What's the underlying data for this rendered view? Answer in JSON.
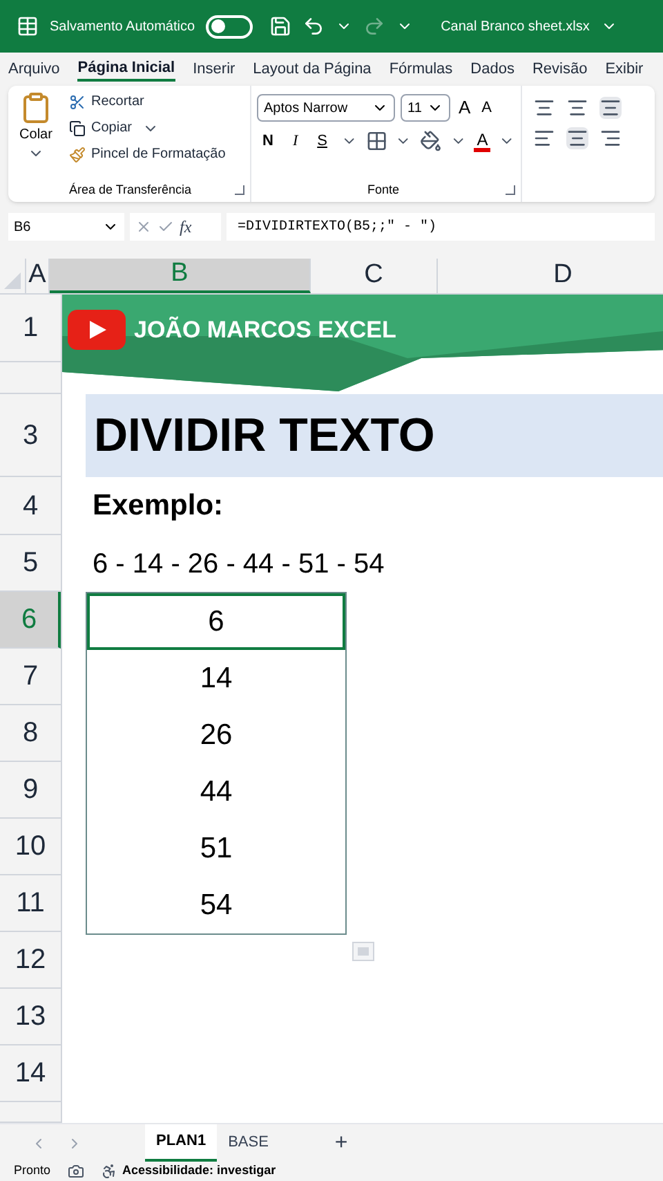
{
  "title_bar": {
    "autosave_label": "Salvamento Automático",
    "autosave_on": false,
    "filename": "Canal Branco sheet.xlsx"
  },
  "menu_tabs": [
    {
      "label": "Arquivo",
      "selected": false
    },
    {
      "label": "Página Inicial",
      "selected": true
    },
    {
      "label": "Inserir",
      "selected": false
    },
    {
      "label": "Layout da Página",
      "selected": false
    },
    {
      "label": "Fórmulas",
      "selected": false
    },
    {
      "label": "Dados",
      "selected": false
    },
    {
      "label": "Revisão",
      "selected": false
    },
    {
      "label": "Exibir",
      "selected": false
    }
  ],
  "ribbon": {
    "clipboard": {
      "paste": "Colar",
      "cut": "Recortar",
      "copy": "Copiar",
      "format_painter": "Pincel de Formatação",
      "label": "Área de Transferência"
    },
    "font": {
      "name": "Aptos Narrow",
      "size": "11",
      "grow": "A",
      "shrink": "A",
      "bold": "N",
      "italic": "I",
      "underline": "S",
      "font_color": "A",
      "label": "Fonte"
    }
  },
  "formula_bar": {
    "name_box": "B6",
    "fx": "fx",
    "formula": "=DIVIDIRTEXTO(B5;;\" - \")"
  },
  "sheet": {
    "columns": [
      {
        "label": "A",
        "selected": false
      },
      {
        "label": "B",
        "selected": true
      },
      {
        "label": "C",
        "selected": false
      },
      {
        "label": "D",
        "selected": false
      }
    ],
    "rows": [
      {
        "label": "1",
        "selected": false
      },
      {
        "label": "",
        "selected": false
      },
      {
        "label": "3",
        "selected": false
      },
      {
        "label": "4",
        "selected": false
      },
      {
        "label": "5",
        "selected": false
      },
      {
        "label": "6",
        "selected": true
      },
      {
        "label": "7",
        "selected": false
      },
      {
        "label": "8",
        "selected": false
      },
      {
        "label": "9",
        "selected": false
      },
      {
        "label": "10",
        "selected": false
      },
      {
        "label": "11",
        "selected": false
      },
      {
        "label": "12",
        "selected": false
      },
      {
        "label": "13",
        "selected": false
      },
      {
        "label": "14",
        "selected": false
      },
      {
        "label": "",
        "selected": false
      }
    ],
    "banner": {
      "title": "JOÃO MARCOS EXCEL"
    },
    "heading": "DIVIDIR TEXTO",
    "example_label": "Exemplo:",
    "source": "6 - 14 - 26 - 44 - 51 - 54",
    "results": [
      {
        "value": "6",
        "selected": true
      },
      {
        "value": "14",
        "selected": false
      },
      {
        "value": "26",
        "selected": false
      },
      {
        "value": "44",
        "selected": false
      },
      {
        "value": "51",
        "selected": false
      },
      {
        "value": "54",
        "selected": false
      }
    ]
  },
  "sheet_tabs": [
    {
      "label": "PLAN1",
      "selected": true
    },
    {
      "label": "BASE",
      "selected": false
    }
  ],
  "add_sheet": "+",
  "status_bar": {
    "ready": "Pronto",
    "accessibility": "Acessibilidade: investigar"
  }
}
